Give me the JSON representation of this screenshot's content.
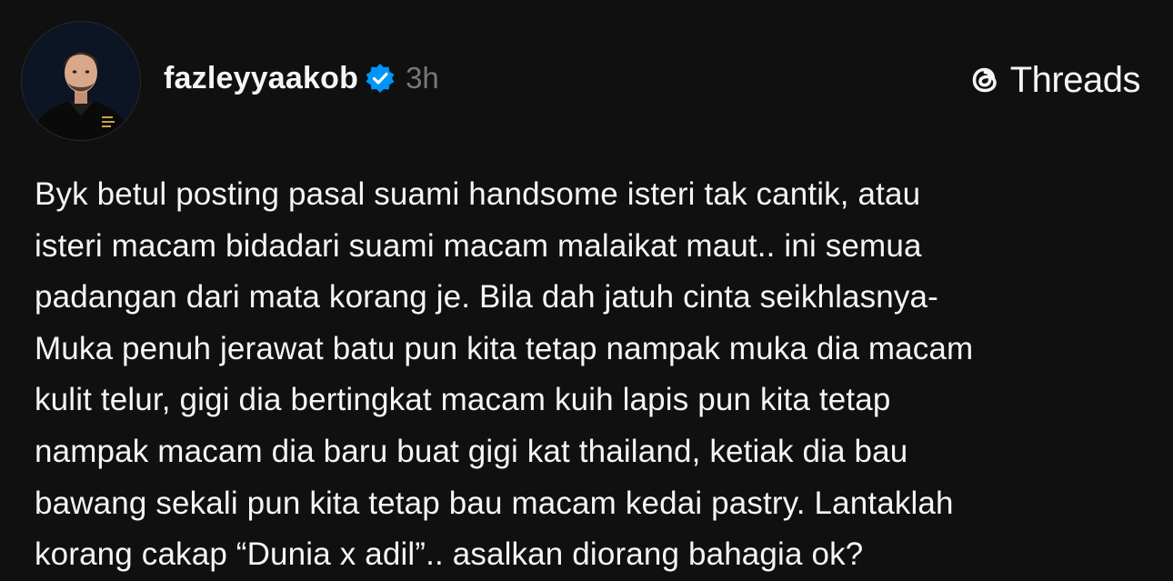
{
  "post": {
    "username": "fazleyyaakob",
    "verified": true,
    "time": "3h",
    "avatar_icon": "profile-photo-chef-avatar",
    "body_lines": [
      "Byk betul posting pasal suami handsome isteri tak cantik, atau",
      "isteri macam bidadari suami macam malaikat maut.. ini semua",
      "padangan dari mata korang je. Bila dah jatuh cinta seikhlasnya-",
      "Muka penuh jerawat batu pun kita tetap nampak muka dia macam",
      "kulit telur, gigi dia bertingkat macam kuih lapis pun kita tetap",
      "nampak macam dia baru buat gigi kat thailand, ketiak dia bau",
      "bawang sekali pun kita tetap bau macam kedai pastry. Lantaklah",
      "korang cakap “Dunia x adil”.. asalkan diorang bahagia ok?"
    ]
  },
  "brand": {
    "name": "Threads",
    "icon": "threads-logo-icon"
  },
  "colors": {
    "background": "#101010",
    "text": "#f3f5f7",
    "secondary_text": "#777777",
    "verified_badge": "#0095f6"
  }
}
